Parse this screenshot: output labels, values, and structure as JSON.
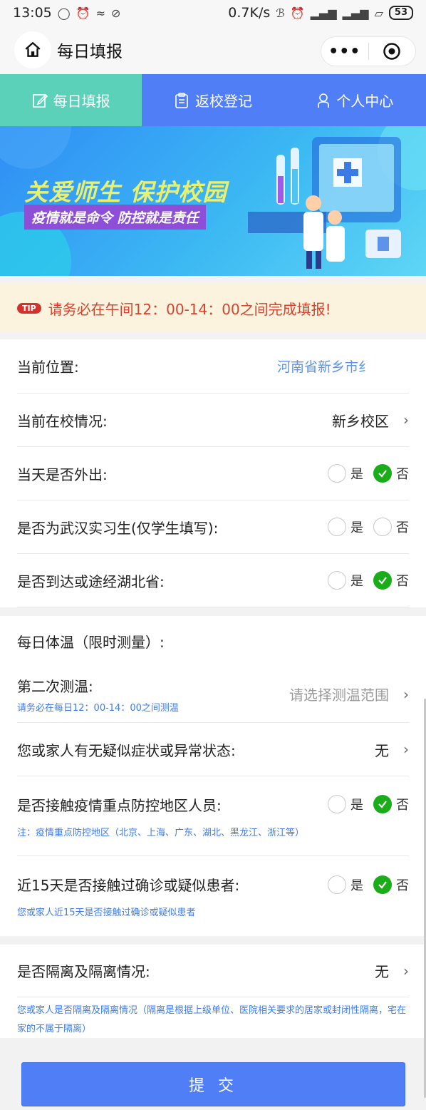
{
  "status_bar": {
    "time": "13:05",
    "speed": "0.7K/s",
    "battery": "53"
  },
  "header": {
    "title": "每日填报",
    "more_label": "•••"
  },
  "tabs": [
    {
      "label": "每日填报",
      "icon": "edit-icon"
    },
    {
      "label": "返校登记",
      "icon": "clipboard-icon"
    },
    {
      "label": "个人中心",
      "icon": "person-icon"
    }
  ],
  "banner": {
    "title": "关爱师生 保护校园",
    "subtitle": "疫情就是命令 防控就是责任"
  },
  "tip": {
    "badge": "TIP",
    "text": "请务必在午间12：00-14：00之间完成填报!"
  },
  "form": {
    "location": {
      "label": "当前位置:",
      "value": "河南省新乡市纟"
    },
    "campus": {
      "label": "当前在校情况:",
      "value": "新乡校区"
    },
    "went_out": {
      "label": "当天是否外出:",
      "yes": "是",
      "no": "否"
    },
    "wuhan_intern": {
      "label": "是否为武汉实习生(仅学生填写):",
      "yes": "是",
      "no": "否"
    },
    "hubei": {
      "label": "是否到达或途经湖北省:",
      "yes": "是",
      "no": "否"
    },
    "temperature": {
      "label": "每日体温（限时测量）:",
      "second_label": "第二次测温:",
      "second_note": "请务必在每日12：00-14：00之间测温",
      "placeholder": "请选择测温范围"
    },
    "symptoms": {
      "label": "您或家人有无疑似症状或异常状态:",
      "value": "无"
    },
    "contact_area": {
      "label": "是否接触疫情重点防控地区人员:",
      "yes": "是",
      "no": "否",
      "note": "注：疫情重点防控地区（北京、上海、广东、湖北、黑龙江、浙江等）"
    },
    "contact_15": {
      "label": "近15天是否接触过确诊或疑似患者:",
      "yes": "是",
      "no": "否",
      "note": "您或家人近15天是否接触过确诊或疑似患者"
    },
    "isolation": {
      "label": "是否隔离及隔离情况:",
      "value": "无",
      "note": "您或家人是否隔离及隔离情况（隔离是根据上级单位、医院相关要求的居家或封闭性隔离，宅在家的不属于隔离）"
    }
  },
  "submit": {
    "label": "提 交"
  },
  "colors": {
    "tab_active": "#5bd1b9",
    "tab_bg": "#4f7ef6",
    "check": "#1aad19",
    "tip_text": "#d5432f",
    "note": "#3e7be6"
  }
}
